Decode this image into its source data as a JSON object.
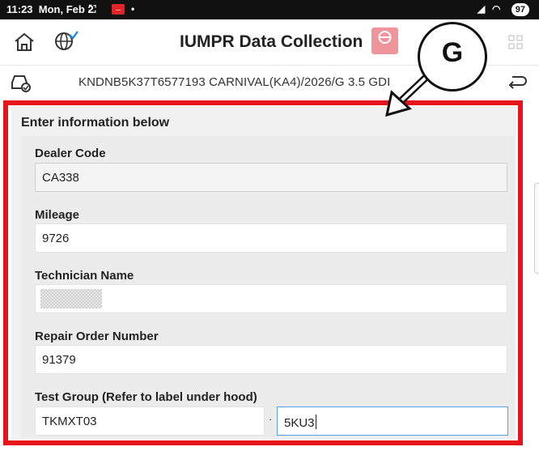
{
  "status_bar": {
    "time": "11:23",
    "date": "Mon, Feb 2",
    "battery": "97",
    "badge": "...",
    "signal_icon": "signal-icon",
    "wifi_icon": "wifi-icon"
  },
  "header": {
    "title": "IUMPR Data Collection",
    "test_badge": "TEST",
    "icons": [
      "home-icon",
      "globe-check-icon",
      "test-badge-icon",
      "grid-icon"
    ]
  },
  "vehicle_bar": {
    "vin_text": "KNDNB5K37T6577193 CARNIVAL(KA4)/2026/G 3.5 GDI",
    "icons": [
      "car-diagnostic-icon",
      "return-icon"
    ]
  },
  "form": {
    "section_title": "Enter information below",
    "dealer_code": {
      "label": "Dealer Code",
      "value": "CA338"
    },
    "mileage": {
      "label": "Mileage",
      "value": "9726"
    },
    "technician_name": {
      "label": "Technician Name",
      "value": ""
    },
    "repair_order": {
      "label": "Repair Order Number",
      "value": "91379"
    },
    "test_group": {
      "label": "Test Group  (Refer to label under hood)",
      "value_1": "TKMXT03",
      "separator": "·",
      "value_2": "5KU3"
    }
  },
  "annotation": {
    "callout_letter": "G",
    "highlight_color": "#e8141b"
  },
  "colors": {
    "accent": "#5aa0e6",
    "highlight": "#e8141b",
    "test_badge": "#f0949b"
  }
}
